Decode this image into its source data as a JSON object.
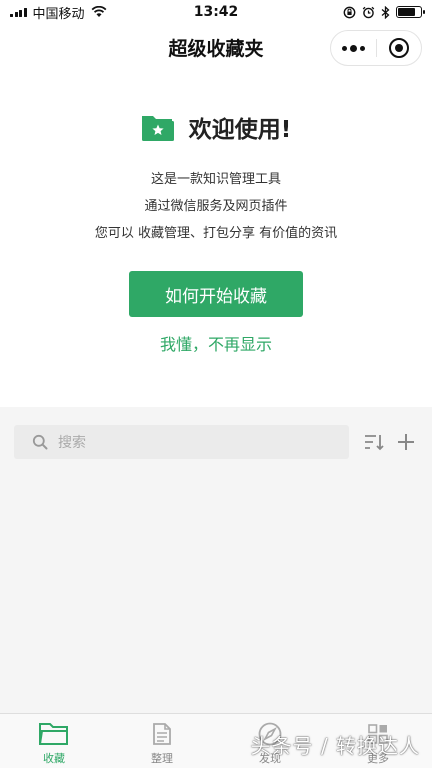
{
  "status_bar": {
    "carrier": "中国移动",
    "time": "13:42",
    "battery_level": 0.75
  },
  "nav": {
    "title": "超级收藏夹"
  },
  "welcome": {
    "title": "欢迎使用!",
    "lines": [
      "这是一款知识管理工具",
      "通过微信服务及网页插件",
      "您可以 收藏管理、打包分享 有价值的资讯"
    ],
    "primary_button": "如何开始收藏",
    "dismiss_link": "我懂，不再显示"
  },
  "search": {
    "placeholder": "搜索"
  },
  "tabs": [
    {
      "label": "收藏",
      "icon": "folder-icon",
      "active": true
    },
    {
      "label": "整理",
      "icon": "document-icon",
      "active": false
    },
    {
      "label": "发现",
      "icon": "compass-icon",
      "active": false
    },
    {
      "label": "更多",
      "icon": "grid-icon",
      "active": false
    }
  ],
  "watermark": "头条号 / 转换达人",
  "colors": {
    "accent": "#2fa866",
    "background": "#f5f5f5",
    "search_bg": "#ebebeb"
  }
}
